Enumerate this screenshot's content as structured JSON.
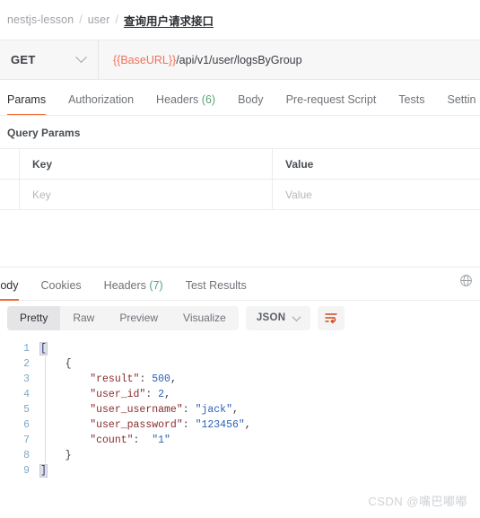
{
  "breadcrumb": {
    "collection": "nestjs-lesson",
    "folder": "user",
    "request": "查询用户请求接口",
    "separator": "/"
  },
  "request_bar": {
    "method": "GET",
    "url_variable": "{{BaseURL}}",
    "url_path": "/api/v1/user/logsByGroup",
    "method_dropdown_icon": "chevron-down-icon"
  },
  "request_tabs": [
    {
      "label": "Params",
      "active": true
    },
    {
      "label": "Authorization",
      "active": false
    },
    {
      "label": "Headers",
      "count": "(6)",
      "active": false
    },
    {
      "label": "Body",
      "active": false
    },
    {
      "label": "Pre-request Script",
      "active": false
    },
    {
      "label": "Tests",
      "active": false
    },
    {
      "label": "Settin",
      "active": false
    }
  ],
  "query_params": {
    "section_label": "Query Params",
    "columns": [
      "Key",
      "Value"
    ],
    "rows": [
      {
        "key_placeholder": "Key",
        "value_placeholder": "Value"
      }
    ]
  },
  "response_tabs": [
    {
      "label": "Body",
      "active": true
    },
    {
      "label": "Cookies",
      "active": false
    },
    {
      "label": "Headers",
      "count": "(7)",
      "active": false
    },
    {
      "label": "Test Results",
      "active": false
    }
  ],
  "response_toolbar": {
    "segments": [
      {
        "label": "Pretty",
        "active": true
      },
      {
        "label": "Raw",
        "active": false
      },
      {
        "label": "Preview",
        "active": false
      },
      {
        "label": "Visualize",
        "active": false
      }
    ],
    "format": "JSON",
    "format_dropdown_icon": "chevron-down-icon",
    "wrap_icon": "word-wrap-icon",
    "network_icon": "globe-icon"
  },
  "response_body": {
    "line_numbers": [
      "1",
      "2",
      "3",
      "4",
      "5",
      "6",
      "7",
      "8",
      "9"
    ],
    "lines": [
      {
        "n": "1",
        "segments": [
          {
            "t": "[",
            "c": "brk"
          }
        ]
      },
      {
        "n": "2",
        "segments": [
          {
            "t": "    ",
            "c": "pun"
          },
          {
            "t": "{",
            "c": "pun"
          }
        ]
      },
      {
        "n": "3",
        "segments": [
          {
            "t": "        ",
            "c": "pun"
          },
          {
            "t": "\"result\"",
            "c": "k"
          },
          {
            "t": ": ",
            "c": "pun"
          },
          {
            "t": "500",
            "c": "num"
          },
          {
            "t": ",",
            "c": "pun"
          }
        ]
      },
      {
        "n": "4",
        "segments": [
          {
            "t": "        ",
            "c": "pun"
          },
          {
            "t": "\"user_id\"",
            "c": "k"
          },
          {
            "t": ": ",
            "c": "pun"
          },
          {
            "t": "2",
            "c": "num"
          },
          {
            "t": ",",
            "c": "pun"
          }
        ]
      },
      {
        "n": "5",
        "segments": [
          {
            "t": "        ",
            "c": "pun"
          },
          {
            "t": "\"user_username\"",
            "c": "k"
          },
          {
            "t": ": ",
            "c": "pun"
          },
          {
            "t": "\"jack\"",
            "c": "str"
          },
          {
            "t": ",",
            "c": "pun"
          }
        ]
      },
      {
        "n": "6",
        "segments": [
          {
            "t": "        ",
            "c": "pun"
          },
          {
            "t": "\"user_password\"",
            "c": "k"
          },
          {
            "t": ": ",
            "c": "pun"
          },
          {
            "t": "\"123456\"",
            "c": "str"
          },
          {
            "t": ",",
            "c": "pun"
          }
        ]
      },
      {
        "n": "7",
        "segments": [
          {
            "t": "        ",
            "c": "pun"
          },
          {
            "t": "\"count\"",
            "c": "k"
          },
          {
            "t": ":  ",
            "c": "pun"
          },
          {
            "t": "\"1\"",
            "c": "str"
          }
        ]
      },
      {
        "n": "8",
        "segments": [
          {
            "t": "    ",
            "c": "pun"
          },
          {
            "t": "}",
            "c": "pun"
          }
        ]
      },
      {
        "n": "9",
        "segments": [
          {
            "t": "]",
            "c": "brk"
          }
        ]
      }
    ],
    "parsed": [
      {
        "result": 500,
        "user_id": 2,
        "user_username": "jack",
        "user_password": "123456",
        "count": "1"
      }
    ]
  },
  "watermark": "CSDN @嘴巴嘟嘟",
  "colors": {
    "accent": "#ef6c33",
    "variable": "#f1705a",
    "json_key": "#8a2b2b",
    "json_value": "#2e62b8",
    "line_number": "#7fa8c4",
    "count_badge": "#5aa27a"
  }
}
